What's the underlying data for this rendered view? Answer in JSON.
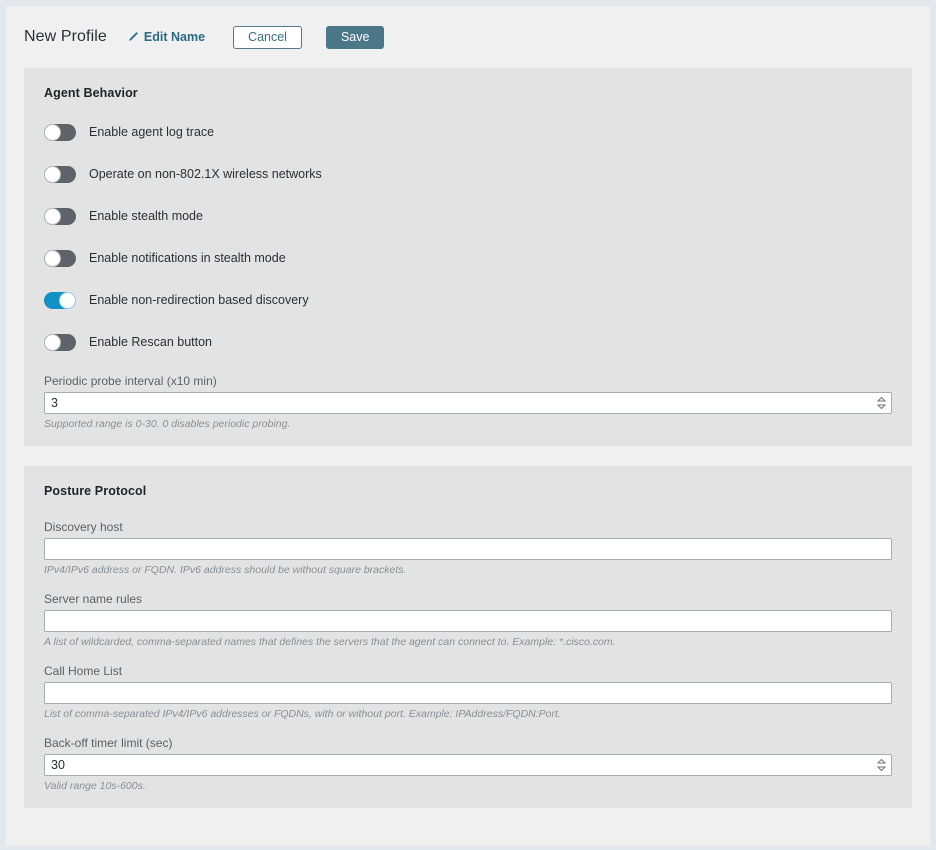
{
  "header": {
    "title": "New Profile",
    "edit_name_label": "Edit Name",
    "edit_name_icon": "pencil-icon",
    "cancel_label": "Cancel",
    "save_label": "Save"
  },
  "colors": {
    "accent_toggle_on": "#1291c6",
    "toggle_off": "#5d6368",
    "save_button": "#4c7788",
    "link_teal": "#2b6a84",
    "card_background": "#e3e3e3",
    "page_background": "#f0f0f1",
    "frame_border": "#e3e8ef"
  },
  "sections": [
    {
      "title": "Agent Behavior",
      "toggles": [
        {
          "label": "Enable agent log trace",
          "on": false
        },
        {
          "label": "Operate on non-802.1X wireless networks",
          "on": false
        },
        {
          "label": "Enable stealth mode",
          "on": false
        },
        {
          "label": "Enable notifications in stealth mode",
          "on": false
        },
        {
          "label": "Enable non-redirection based discovery",
          "on": true
        },
        {
          "label": "Enable Rescan button",
          "on": false
        }
      ],
      "fields": [
        {
          "label": "Periodic probe interval (x10 min)",
          "value": "3",
          "placeholder": "",
          "hint": "Supported range is 0-30. 0 disables periodic probing.",
          "spinner": true
        }
      ]
    },
    {
      "title": "Posture Protocol",
      "toggles": [],
      "fields": [
        {
          "label": "Discovery host",
          "value": "",
          "placeholder": "",
          "hint": "IPv4/IPv6 address or FQDN. IPv6 address should be without square brackets.",
          "spinner": false
        },
        {
          "label": "Server name rules",
          "value": "",
          "placeholder": "",
          "hint": "A list of wildcarded, comma-separated names that defines the servers that the agent can connect to. Example: *.cisco.com.",
          "spinner": false
        },
        {
          "label": "Call Home List",
          "value": "",
          "placeholder": "",
          "hint": "List of comma-separated IPv4/IPv6 addresses or FQDNs, with or without port. Example: IPAddress/FQDN:Port.",
          "spinner": false
        },
        {
          "label": "Back-off timer limit (sec)",
          "value": "30",
          "placeholder": "",
          "hint": "Valid range 10s-600s.",
          "spinner": true
        }
      ]
    }
  ]
}
